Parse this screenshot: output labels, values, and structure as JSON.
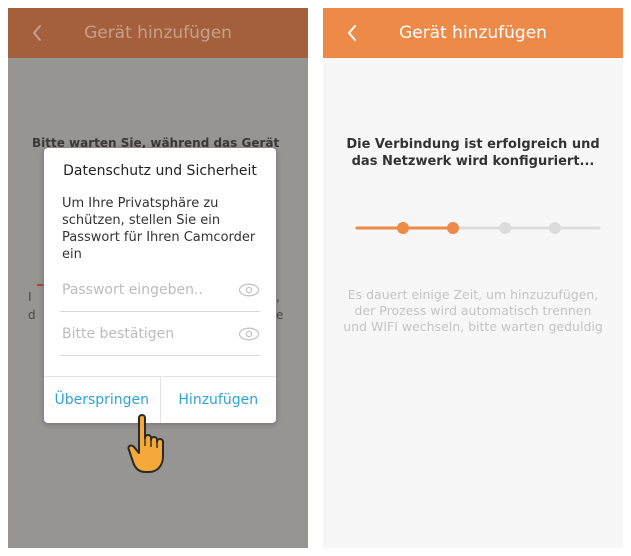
{
  "left_screen": {
    "header": {
      "title": "Gerät hinzufügen",
      "back_icon": "chevron-left-icon"
    },
    "background_text": "Bitte warten Sie, während das Gerät",
    "background_fragments": [
      "I",
      "d",
      ",",
      "e"
    ],
    "dialog": {
      "title": "Datenschutz und Sicherheit",
      "message": "Um Ihre Privatsphäre zu schützen, stellen Sie ein Passwort für Ihren Camcorder ein",
      "password_placeholder": "Passwort eingeben..",
      "confirm_placeholder": "Bitte bestätigen",
      "skip_label": "Überspringen",
      "add_label": "Hinzufügen"
    },
    "pointer_icon": "hand-pointer-icon"
  },
  "right_screen": {
    "header": {
      "title": "Gerät hinzufügen",
      "back_icon": "chevron-left-icon"
    },
    "status": "Die Verbindung ist erfolgreich und das Netzwerk wird konfiguriert...",
    "progress": {
      "total_steps": 4,
      "completed_steps": 2
    },
    "hint": "Es dauert einige Zeit, um hinzuzufügen, der Prozess wird automatisch trennen und WIFI wechseln, bitte warten geduldig"
  },
  "colors": {
    "accent_orange": "#ee8a47",
    "dimmed_header": "#a4603c",
    "link_blue": "#2ea3d6",
    "progress_inactive": "#dcdcdc"
  }
}
